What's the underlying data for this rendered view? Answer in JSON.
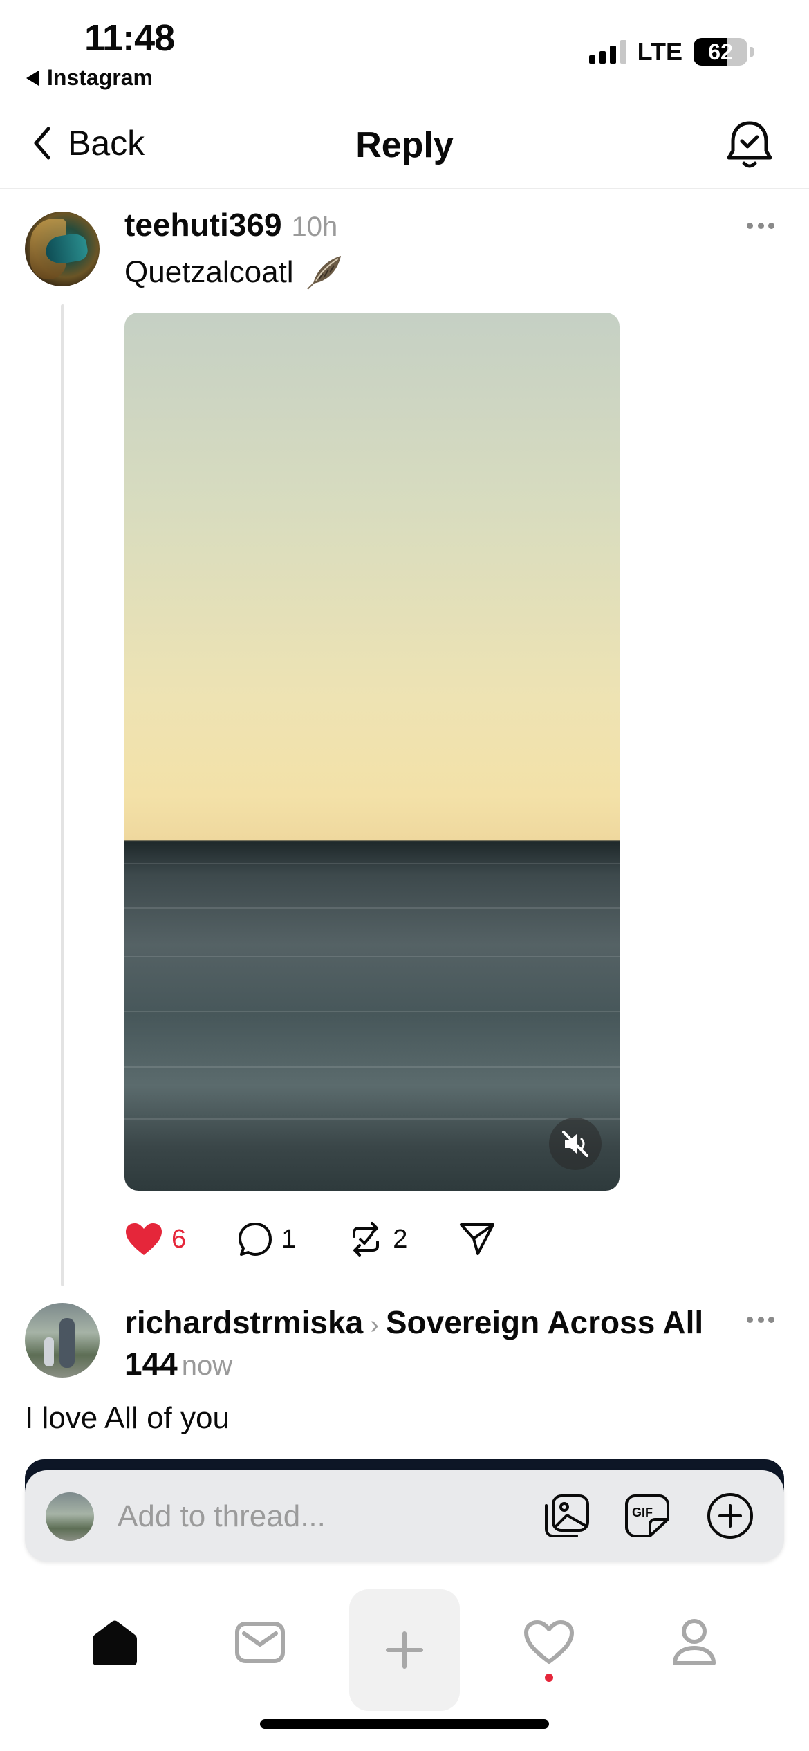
{
  "status_bar": {
    "time": "11:48",
    "back_app": "Instagram",
    "network": "LTE",
    "battery": "62",
    "battery_level": 0.62
  },
  "nav": {
    "back_label": "Back",
    "title": "Reply"
  },
  "post": {
    "username": "teehuti369",
    "time": "10h",
    "text": "Quetzalcoatl",
    "likes": "6",
    "comments": "1",
    "reposts": "2"
  },
  "reply": {
    "username": "richardstrmiska",
    "community": "Sovereign Across All 144",
    "time": "now",
    "text": "I love All of you"
  },
  "composer": {
    "placeholder": "Add to thread..."
  },
  "colors": {
    "like_red": "#e5263a",
    "secondary_gray": "#9a9a9a"
  },
  "icons": {
    "nav": [
      "chevron-left-icon",
      "bell-check-icon"
    ],
    "post": [
      "more-icon",
      "feather-icon",
      "mute-icon"
    ],
    "actions": [
      "heart-icon",
      "comment-icon",
      "repost-icon",
      "share-icon"
    ],
    "composer": [
      "image-icon",
      "gif-icon",
      "add-circle-icon"
    ],
    "tabs": [
      "home-icon",
      "inbox-icon",
      "plus-icon",
      "heart-icon",
      "profile-icon"
    ]
  }
}
